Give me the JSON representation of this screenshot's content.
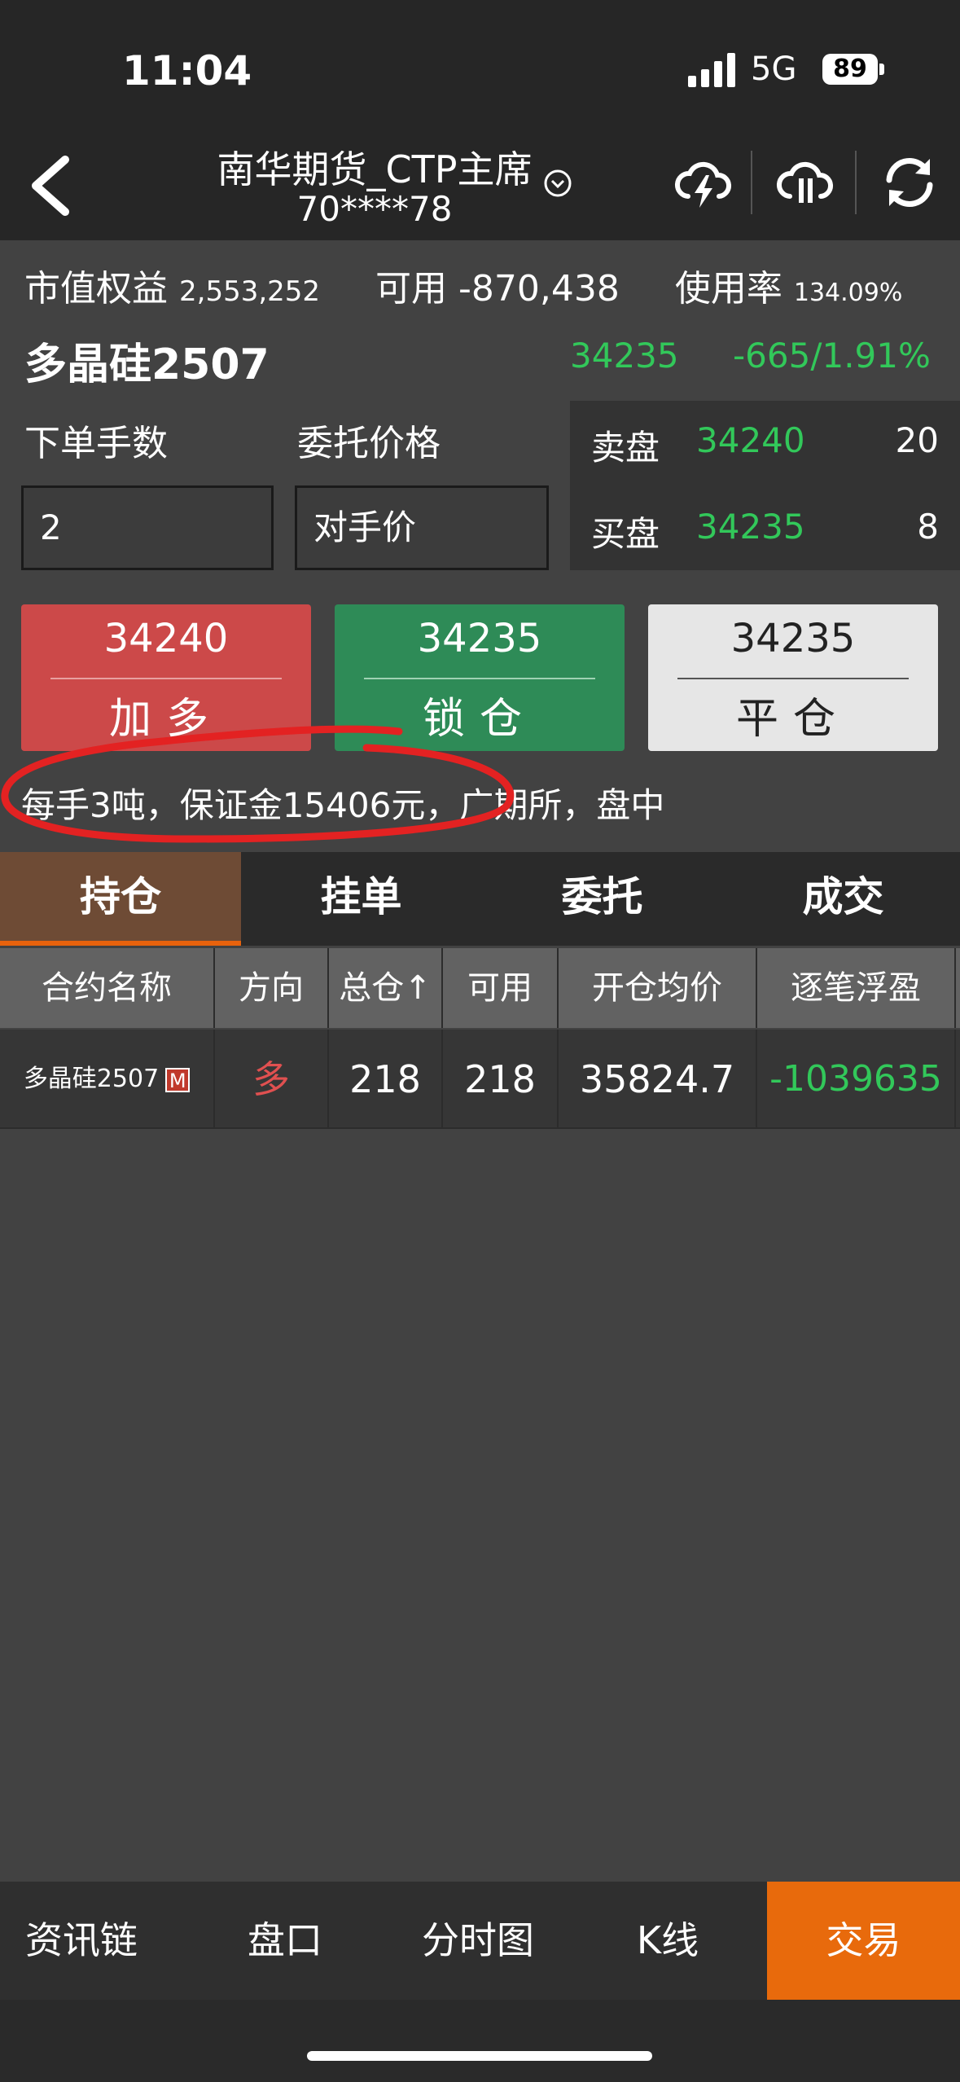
{
  "status_bar": {
    "time": "11:04",
    "network": "5G",
    "battery": "89"
  },
  "header": {
    "title_line1": "南华期货_CTP主席",
    "title_line2": "70****78",
    "icons": [
      "back-icon",
      "chevron-down-icon",
      "cloud-bolt-icon",
      "cloud-pause-icon",
      "refresh-icon"
    ]
  },
  "account": {
    "equity_label": "市值权益",
    "equity_value": "2,553,252",
    "available_label": "可用",
    "available_value": "-870,438",
    "usage_label": "使用率",
    "usage_value": "134.09%"
  },
  "contract": {
    "name": "多晶硅2507",
    "last_price": "34235",
    "change": "-665/1.91%"
  },
  "order_form": {
    "qty_label": "下单手数",
    "qty_value": "2",
    "price_label": "委托价格",
    "price_value": "对手价"
  },
  "order_book": {
    "ask_label": "卖盘",
    "ask_price": "34240",
    "ask_volume": "20",
    "bid_label": "买盘",
    "bid_price": "34235",
    "bid_volume": "8"
  },
  "actions": {
    "long": {
      "price": "34240",
      "label": "加多"
    },
    "lock": {
      "price": "34235",
      "label": "锁仓"
    },
    "close": {
      "price": "34235",
      "label": "平仓"
    }
  },
  "info_line": "每手3吨，保证金15406元，广期所，盘中",
  "tabs": [
    "持仓",
    "挂单",
    "委托",
    "成交"
  ],
  "positions_table": {
    "headers": [
      "合约名称",
      "方向",
      "总仓↑",
      "可用",
      "开仓均价",
      "逐笔浮盈"
    ],
    "rows": [
      {
        "name": "多晶硅2507",
        "badge": "M",
        "direction": "多",
        "total": "218",
        "available": "218",
        "avg_price": "35824.7",
        "pnl": "-1039635"
      }
    ]
  },
  "bottom_nav": [
    "资讯链",
    "盘口",
    "分时图",
    "K线",
    "交易"
  ],
  "colors": {
    "up_green": "#32c85a",
    "down_red": "#cc4949",
    "accent_orange": "#e86a0c"
  }
}
